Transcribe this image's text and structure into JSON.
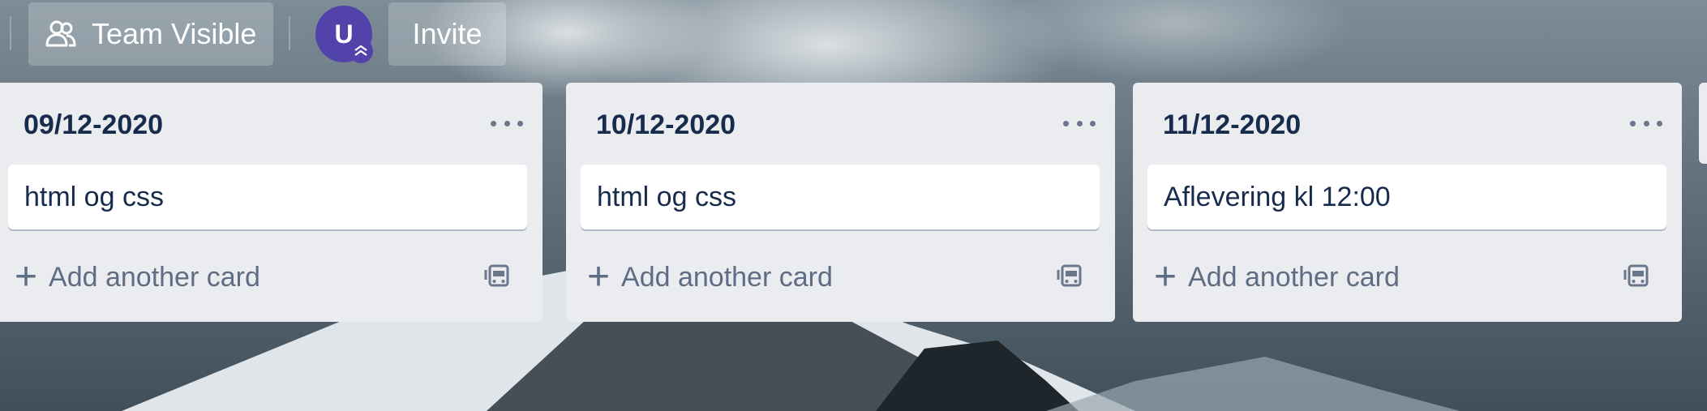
{
  "header": {
    "visibility_label": "Team Visible",
    "avatar_initial": "U",
    "invite_label": "Invite"
  },
  "lists": [
    {
      "title": "09/12-2020",
      "cards": [
        "html og css"
      ],
      "add_label": "Add another card"
    },
    {
      "title": "10/12-2020",
      "cards": [
        "html og css"
      ],
      "add_label": "Add another card"
    },
    {
      "title": "11/12-2020",
      "cards": [
        "Aflevering kl 12:00"
      ],
      "add_label": "Add another card"
    }
  ],
  "icons": [
    "team-icon",
    "admin-badge-icon",
    "more-icon",
    "plus-icon",
    "template-icon"
  ],
  "colors": {
    "avatar": "#5243aa",
    "list_bg": "#ebecf0",
    "card_bg": "#ffffff",
    "title_text": "#172b4d",
    "muted_text": "#5e6c84"
  }
}
